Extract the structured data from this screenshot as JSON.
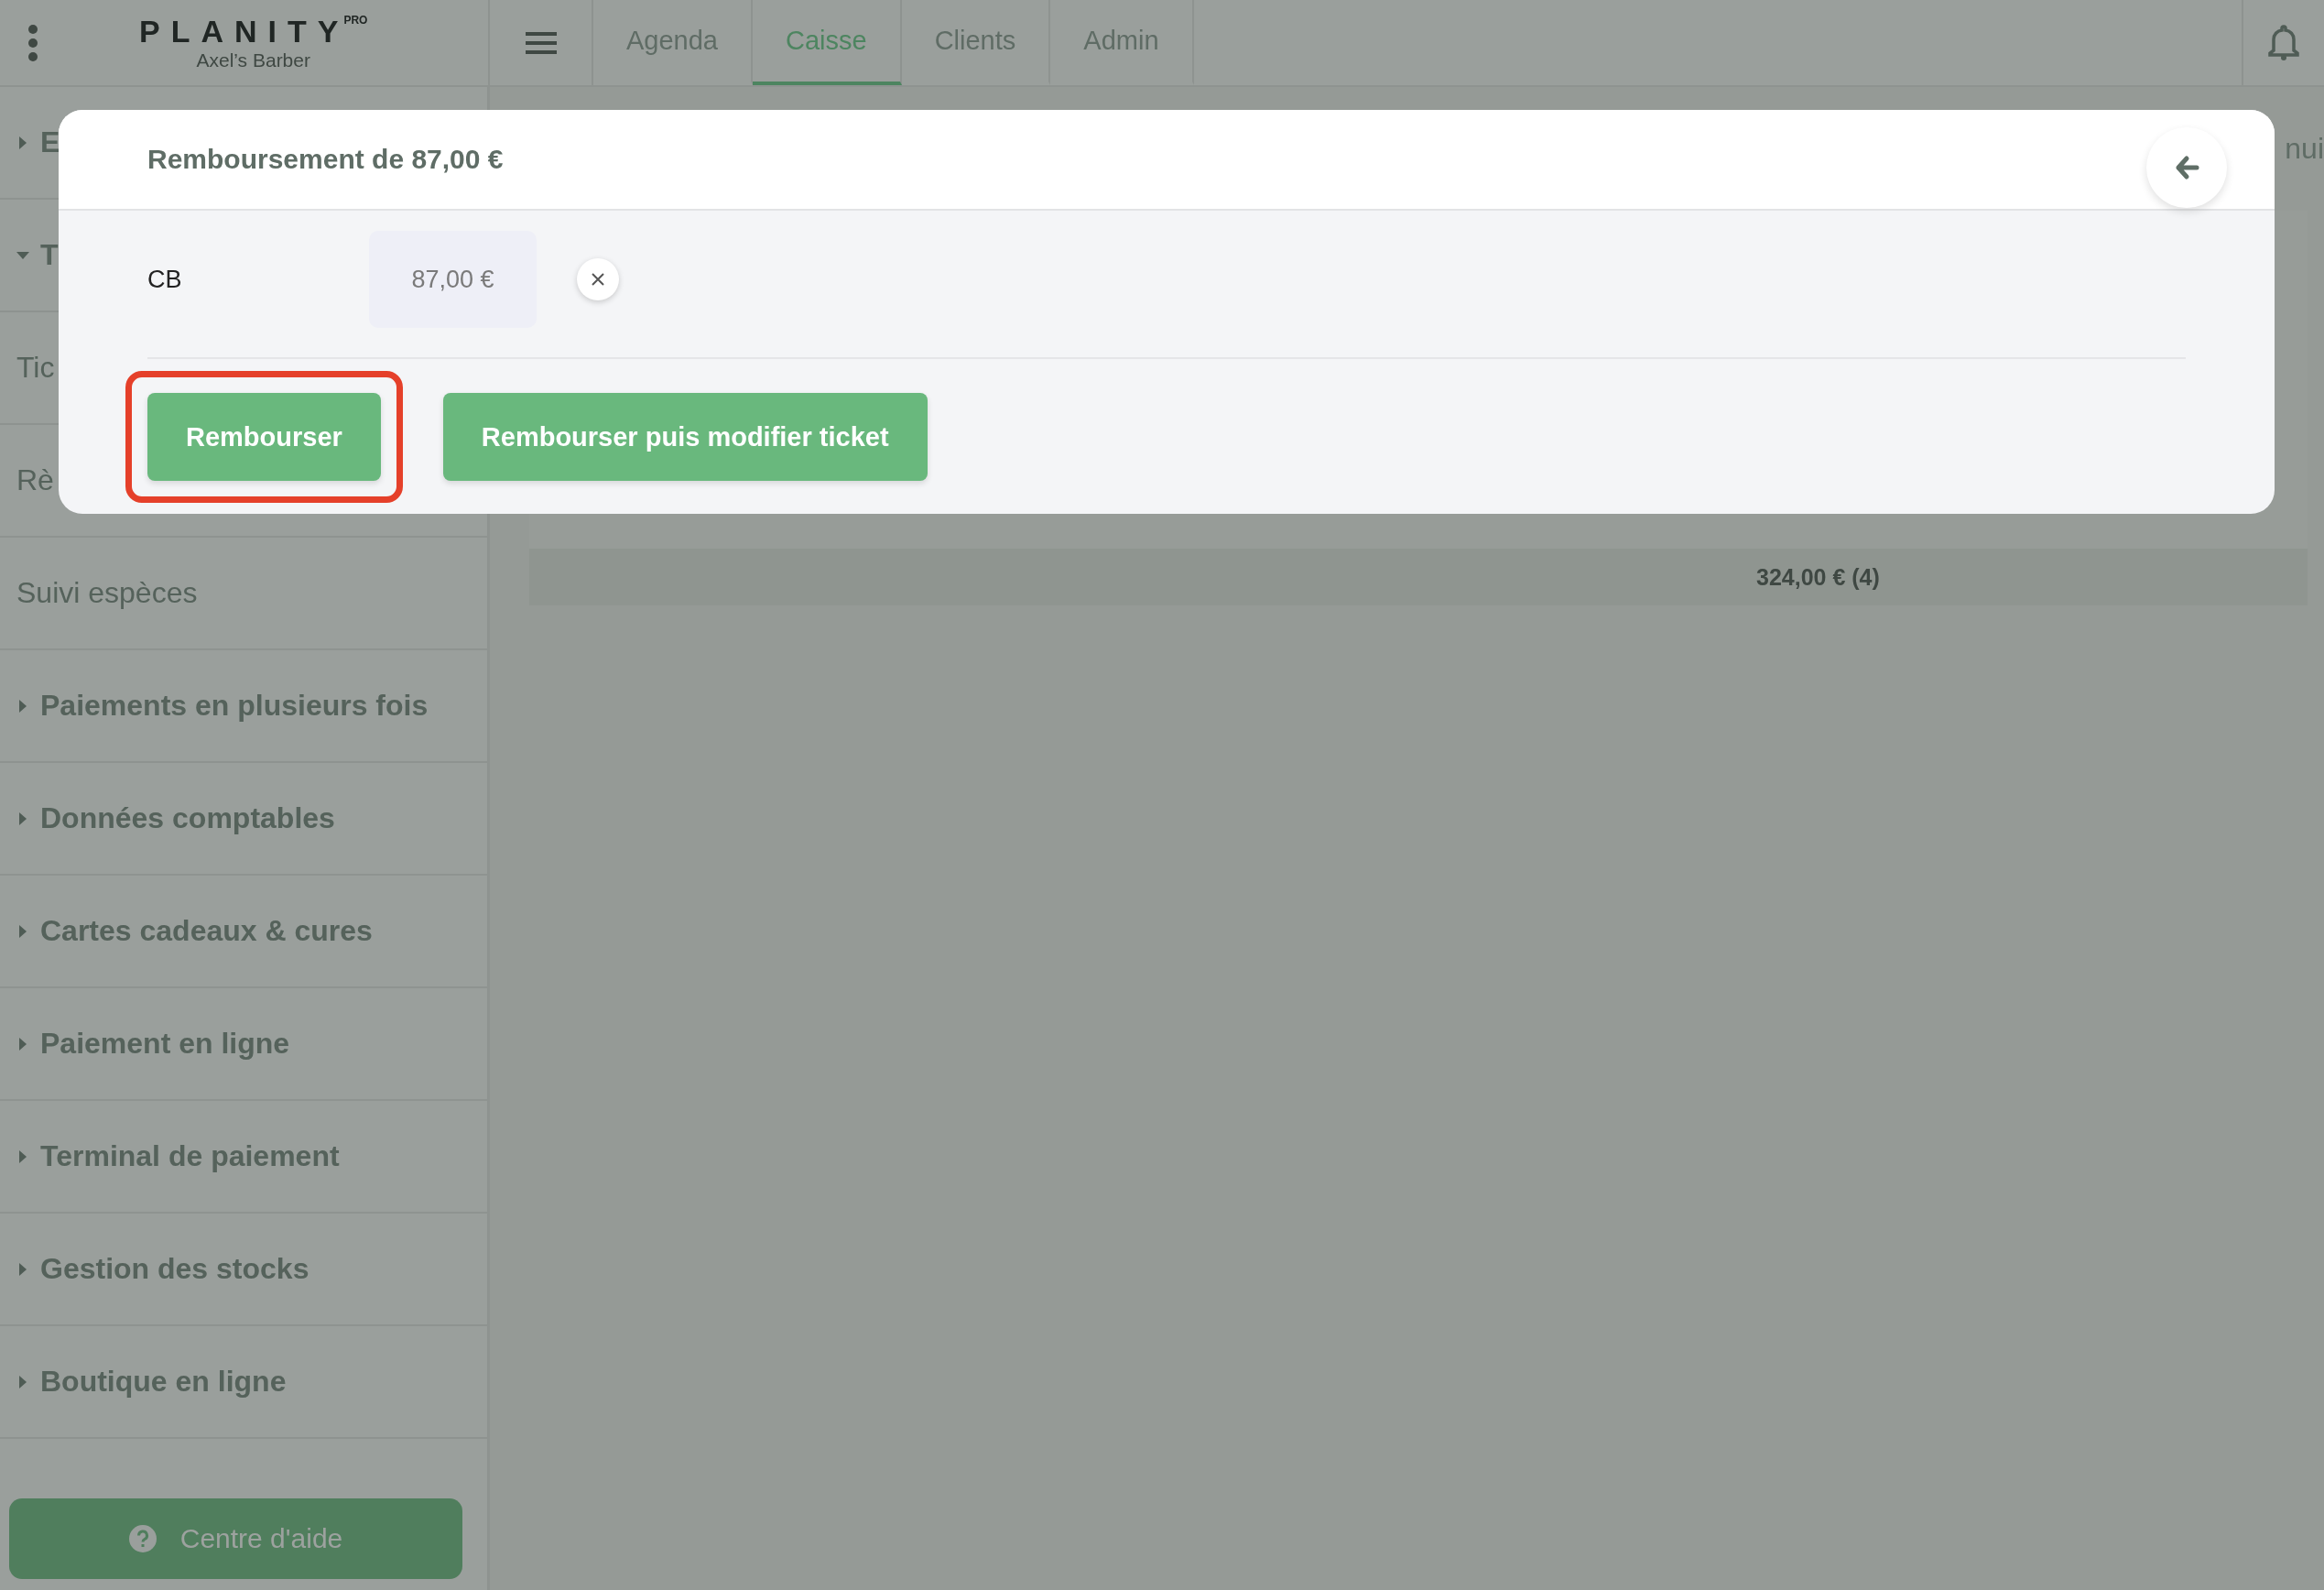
{
  "topbar": {
    "logo": "PLANITY",
    "logo_badge": "PRO",
    "salon": "Axel’s Barber",
    "tabs": [
      {
        "label": "Agenda",
        "selected": false
      },
      {
        "label": "Caisse",
        "selected": true
      },
      {
        "label": "Clients",
        "selected": false
      },
      {
        "label": "Admin",
        "selected": false
      }
    ]
  },
  "sidebar": {
    "items": [
      {
        "label": "E",
        "kind": "group",
        "expanded": false
      },
      {
        "label": "T",
        "kind": "group",
        "expanded": true,
        "children": [
          {
            "label": "Tic",
            "kind": "link"
          },
          {
            "label": "Rè",
            "kind": "link"
          },
          {
            "label": "Suivi espèces",
            "kind": "link"
          }
        ]
      },
      {
        "label": "Paiements en plusieurs fois",
        "kind": "group",
        "expanded": false
      },
      {
        "label": "Données comptables",
        "kind": "group",
        "expanded": false
      },
      {
        "label": "Cartes cadeaux & cures",
        "kind": "group",
        "expanded": false
      },
      {
        "label": "Paiement en ligne",
        "kind": "group",
        "expanded": false
      },
      {
        "label": "Terminal de paiement",
        "kind": "group",
        "expanded": false
      },
      {
        "label": "Gestion des stocks",
        "kind": "group",
        "expanded": false
      },
      {
        "label": "Boutique en ligne",
        "kind": "group",
        "expanded": false
      }
    ],
    "help_button": "Centre d'aide"
  },
  "content": {
    "header_fragment": "nui",
    "total": "324,00 € (4)"
  },
  "modal": {
    "title": "Remboursement de 87,00 €",
    "payments": [
      {
        "method": "CB",
        "amount": "87,00 €"
      }
    ],
    "buttons": [
      {
        "label": "Rembourser",
        "highlighted": true
      },
      {
        "label": "Rembourser puis modifier ticket",
        "highlighted": false
      }
    ]
  }
}
